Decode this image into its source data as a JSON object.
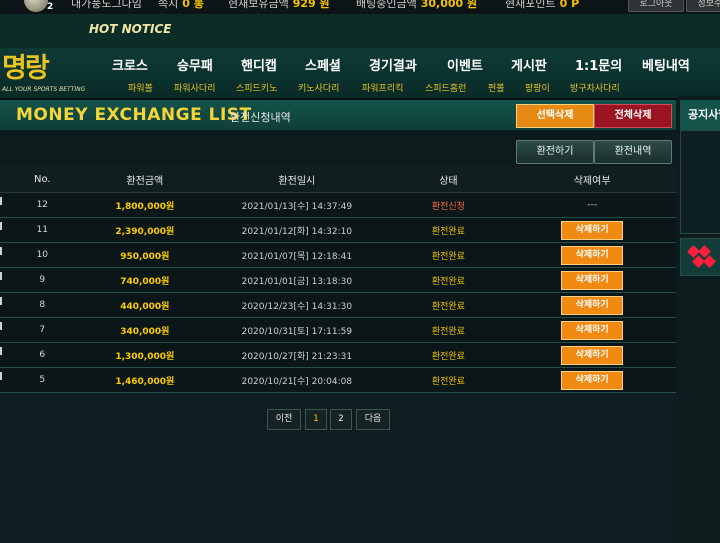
{
  "topbar": {
    "level": "2",
    "username": "내가풍도그다임",
    "message_label": "쪽지",
    "message_count": "0 통",
    "holding_label": "현재보유금액",
    "holding_value": "929 원",
    "betting_label": "배팅중인금액",
    "betting_value": "30,000 원",
    "point_label": "현재포인트",
    "point_value": "0 P",
    "logout_label": "로그아웃",
    "info_label": "정보수정"
  },
  "notice": {
    "label": "HOT NOTICE"
  },
  "logo": {
    "main": "명랑",
    "sub": "ALL YOUR SPORTS BETTING"
  },
  "nav": {
    "menu": [
      "크로스",
      "승무패",
      "핸디캡",
      "스페셜",
      "경기결과",
      "이벤트",
      "게시판",
      "1:1문의",
      "베팅내역"
    ],
    "submenu": [
      "파워볼",
      "파워사다리",
      "스피드키노",
      "키노사다리",
      "파워프리킥",
      "스피드홈런",
      "펀볼",
      "팡팡이",
      "방구차사다리"
    ]
  },
  "title": {
    "main": "MONEY EXCHANGE LIST",
    "sub": "환전신청내역",
    "select_delete": "선택삭제",
    "delete_all": "전체삭제"
  },
  "tabs": {
    "exchange": "환전하기",
    "history": "환전내역"
  },
  "table": {
    "headers": [
      "No.",
      "환전금액",
      "환전일시",
      "상태",
      "삭제여부"
    ],
    "rows": [
      {
        "no": "12",
        "amount": "1,800,000원",
        "datetime": "2021/01/13[수] 14:37:49",
        "status": "환전신청",
        "action": "---"
      },
      {
        "no": "11",
        "amount": "2,390,000원",
        "datetime": "2021/01/12[화] 14:32:10",
        "status": "환전완료",
        "action": "삭제하기"
      },
      {
        "no": "10",
        "amount": "950,000원",
        "datetime": "2021/01/07[목] 12:18:41",
        "status": "환전완료",
        "action": "삭제하기"
      },
      {
        "no": "9",
        "amount": "740,000원",
        "datetime": "2021/01/01[금] 13:18:30",
        "status": "환전완료",
        "action": "삭제하기"
      },
      {
        "no": "8",
        "amount": "440,000원",
        "datetime": "2020/12/23[수] 14:31:30",
        "status": "환전완료",
        "action": "삭제하기"
      },
      {
        "no": "7",
        "amount": "340,000원",
        "datetime": "2020/10/31[토] 17:11:59",
        "status": "환전완료",
        "action": "삭제하기"
      },
      {
        "no": "6",
        "amount": "1,300,000원",
        "datetime": "2020/10/27[화] 21:23:31",
        "status": "환전완료",
        "action": "삭제하기"
      },
      {
        "no": "5",
        "amount": "1,460,000원",
        "datetime": "2020/10/21[수] 20:04:08",
        "status": "환전완료",
        "action": "삭제하기"
      }
    ]
  },
  "pagination": {
    "prev": "이전",
    "pages": [
      "1",
      "2"
    ],
    "next": "다음"
  },
  "right_panel": {
    "title": "공지사항"
  },
  "colors": {
    "accent_gold": "#f4d43a",
    "orange_button": "#e78a14",
    "red_button": "#9b1422",
    "status_request": "#ff6a3a",
    "status_done": "#f2c200"
  }
}
